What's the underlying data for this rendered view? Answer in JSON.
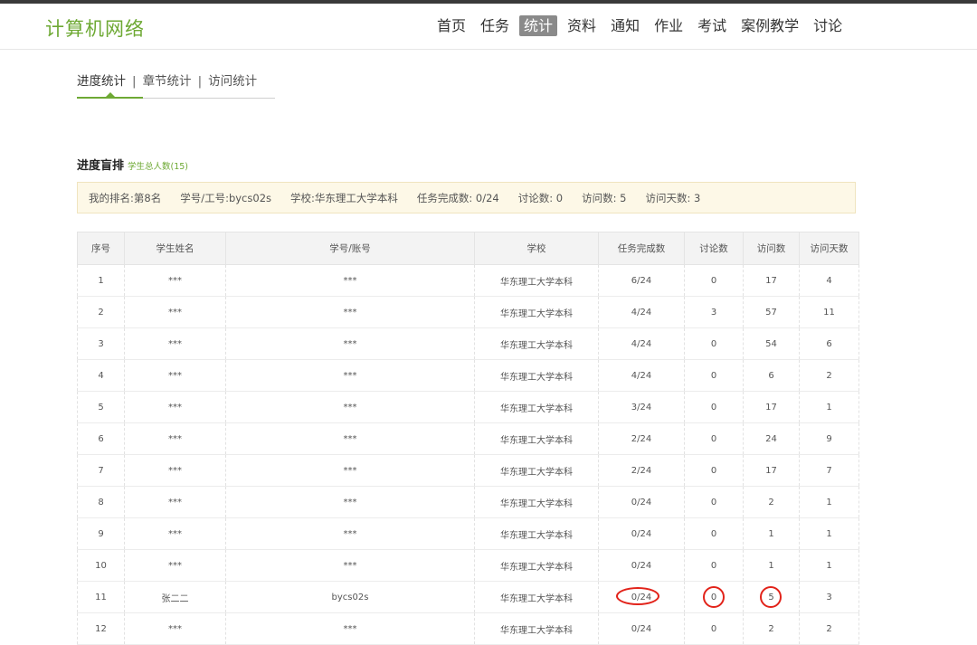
{
  "brand": "计算机网络",
  "nav": [
    "首页",
    "任务",
    "统计",
    "资料",
    "通知",
    "作业",
    "考试",
    "案例教学",
    "讨论"
  ],
  "nav_active_index": 2,
  "subtabs": [
    "进度统计",
    "章节统计",
    "访问统计"
  ],
  "subtab_sep": "|",
  "section": {
    "title": "进度盲排",
    "count_label": "学生总人数(15)"
  },
  "mybar": {
    "rank": "我的排名:第8名",
    "id": "学号/工号:bycs02s",
    "school": "学校:华东理工大学本科",
    "tasks": "任务完成数: 0/24",
    "discussions": "讨论数: 0",
    "visits": "访问数: 5",
    "visit_days": "访问天数: 3"
  },
  "table": {
    "headers": [
      "序号",
      "学生姓名",
      "学号/账号",
      "学校",
      "任务完成数",
      "讨论数",
      "访问数",
      "访问天数"
    ],
    "rows": [
      [
        "1",
        "***",
        "***",
        "华东理工大学本科",
        "6/24",
        "0",
        "17",
        "4"
      ],
      [
        "2",
        "***",
        "***",
        "华东理工大学本科",
        "4/24",
        "3",
        "57",
        "11"
      ],
      [
        "3",
        "***",
        "***",
        "华东理工大学本科",
        "4/24",
        "0",
        "54",
        "6"
      ],
      [
        "4",
        "***",
        "***",
        "华东理工大学本科",
        "4/24",
        "0",
        "6",
        "2"
      ],
      [
        "5",
        "***",
        "***",
        "华东理工大学本科",
        "3/24",
        "0",
        "17",
        "1"
      ],
      [
        "6",
        "***",
        "***",
        "华东理工大学本科",
        "2/24",
        "0",
        "24",
        "9"
      ],
      [
        "7",
        "***",
        "***",
        "华东理工大学本科",
        "2/24",
        "0",
        "17",
        "7"
      ],
      [
        "8",
        "***",
        "***",
        "华东理工大学本科",
        "0/24",
        "0",
        "2",
        "1"
      ],
      [
        "9",
        "***",
        "***",
        "华东理工大学本科",
        "0/24",
        "0",
        "1",
        "1"
      ],
      [
        "10",
        "***",
        "***",
        "华东理工大学本科",
        "0/24",
        "0",
        "1",
        "1"
      ],
      [
        "11",
        "张二二",
        "bycs02s",
        "华东理工大学本科",
        "0/24",
        "0",
        "5",
        "3"
      ],
      [
        "12",
        "***",
        "***",
        "华东理工大学本科",
        "0/24",
        "0",
        "2",
        "2"
      ]
    ]
  },
  "colors": {
    "accent": "#6ea934",
    "highlight_ring": "#e2231a",
    "mybar_bg": "#fdf8e7"
  }
}
